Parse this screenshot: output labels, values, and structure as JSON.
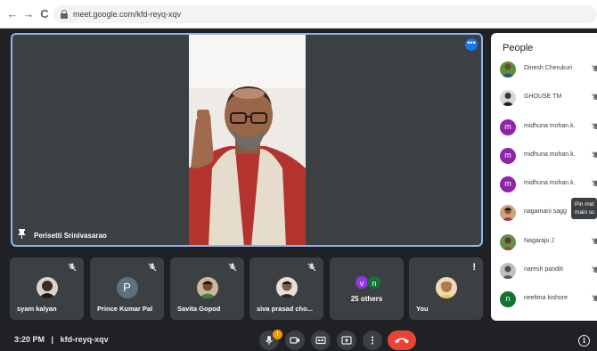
{
  "browser": {
    "url": "meet.google.com/kfd-reyq-xqv",
    "back_glyph": "←",
    "forward_glyph": "→",
    "reload_glyph": "C"
  },
  "main_speaker": {
    "name": "Perisetti Srinivasarao",
    "more_glyph": "•••"
  },
  "tiles": [
    {
      "name": "syam kalyan",
      "type": "photo"
    },
    {
      "name": "Prince Kumar Pal",
      "type": "letter",
      "letter": "P",
      "color": "#5f6f7f"
    },
    {
      "name": "Savita Gopod",
      "type": "photo"
    },
    {
      "name": "siva prasad cho...",
      "type": "photo"
    },
    {
      "name": "25 others",
      "type": "others",
      "letters": [
        "v",
        "n"
      ],
      "colors": [
        "#9334e6",
        "#137333"
      ]
    },
    {
      "name": "You",
      "type": "photo",
      "alert": "!"
    }
  ],
  "bottom_bar": {
    "time": "3:20 PM",
    "separator": "|",
    "meeting_code": "kfd-reyq-xqv",
    "mic_badge": "!",
    "info_glyph": "i"
  },
  "people": {
    "title": "People",
    "list": [
      {
        "name": "Dinesh Cherukuri",
        "type": "photo"
      },
      {
        "name": "GHOUSE TM",
        "type": "photo"
      },
      {
        "name": "midhuna mohan.k.",
        "type": "letter",
        "letter": "m",
        "color": "#8e24aa"
      },
      {
        "name": "midhuna mohan.k.",
        "type": "letter",
        "letter": "m",
        "color": "#8e24aa"
      },
      {
        "name": "midhuna mohan.k.",
        "type": "letter",
        "letter": "m",
        "color": "#8e24aa"
      },
      {
        "name": "nagamani sagg",
        "type": "photo"
      },
      {
        "name": "Nagaraju J",
        "type": "photo"
      },
      {
        "name": "naresh panditi",
        "type": "photo"
      },
      {
        "name": "neelima kishore",
        "type": "letter",
        "letter": "n",
        "color": "#137333"
      }
    ],
    "tooltip_lines": [
      "Pin mid",
      "main sc"
    ]
  },
  "colors": {
    "background": "#202124",
    "tile": "#3c4043",
    "accent_blue": "#8ab4f8",
    "hangup_red": "#ea4335",
    "badge_orange": "#f29900"
  },
  "icons": {
    "mic_off": "mic-off-icon",
    "camera": "camera-icon",
    "captions": "closed-captions-icon",
    "present": "present-screen-icon",
    "more": "more-options-icon",
    "hangup": "hang-up-icon",
    "info": "info-icon",
    "pin": "pin-icon"
  }
}
